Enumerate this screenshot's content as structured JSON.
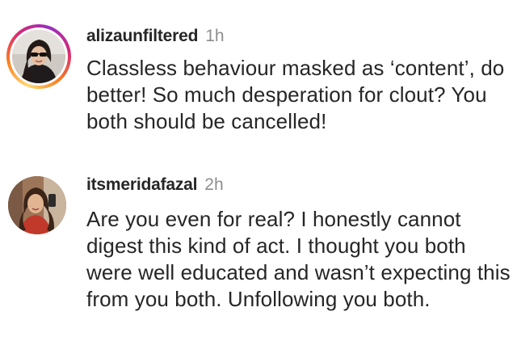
{
  "comments": [
    {
      "username": "alizaunfiltered",
      "time": "1h",
      "text": "Classless behaviour masked as ‘content’, do better! So much desperation for clout? You both should be cancelled!"
    },
    {
      "username": "itsmeridafazal",
      "time": "2h",
      "text": "Are you even for real? I honestly cannot digest this kind of act. I thought you both were well educated and wasn’t expecting this from you both. Unfollowing you both."
    }
  ],
  "colors": {
    "username": "#262626",
    "timestamp": "#8e8e8e",
    "text": "#262626",
    "story_ring": [
      "#feda75",
      "#fa7e1e",
      "#d62976",
      "#962fbf"
    ]
  }
}
